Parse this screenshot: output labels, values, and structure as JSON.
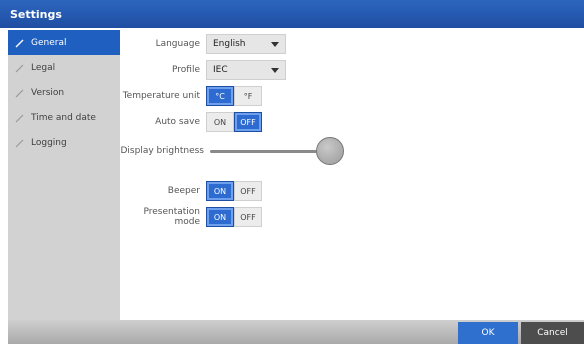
{
  "window": {
    "title": "Settings"
  },
  "sidebar": {
    "items": [
      {
        "label": "General",
        "active": true
      },
      {
        "label": "Legal",
        "active": false
      },
      {
        "label": "Version",
        "active": false
      },
      {
        "label": "Time and date",
        "active": false
      },
      {
        "label": "Logging",
        "active": false
      }
    ]
  },
  "general": {
    "language": {
      "label": "Language",
      "value": "English"
    },
    "profile": {
      "label": "Profile",
      "value": "IEC"
    },
    "temperature_unit": {
      "label": "Temperature unit",
      "options": [
        "°C",
        "°F"
      ],
      "selected": "°C"
    },
    "auto_save": {
      "label": "Auto save",
      "options": [
        "ON",
        "OFF"
      ],
      "selected": "OFF"
    },
    "display_brightness": {
      "label": "Display brightness",
      "level": 1.0
    },
    "beeper": {
      "label": "Beeper",
      "options": [
        "ON",
        "OFF"
      ],
      "selected": "ON"
    },
    "presentation_mode": {
      "label": "Presentation mode",
      "options": [
        "ON",
        "OFF"
      ],
      "selected": "ON"
    }
  },
  "footer": {
    "ok_label": "OK",
    "cancel_label": "Cancel"
  },
  "colors": {
    "accent": "#1e5fbf",
    "titlebar": "#2d66bf",
    "sidebar_bg": "#d2d2d2"
  }
}
